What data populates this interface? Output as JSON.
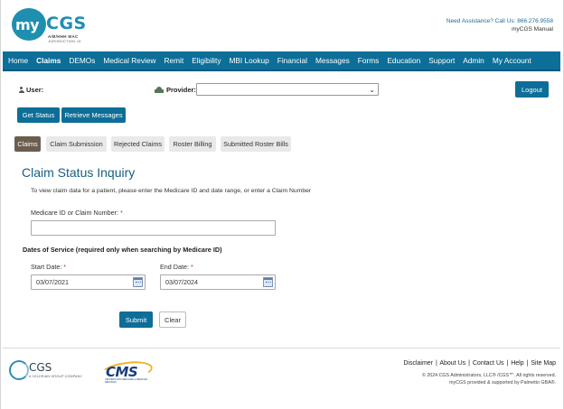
{
  "header": {
    "logo_my": "my",
    "logo_cgs": "CGS",
    "logo_line1": "A/B/HHH MAC",
    "logo_line2": "JURISDICTION 15",
    "assistance": "Need Assistance? Call Us: 866.276.9558",
    "manual": "myCGS Manual"
  },
  "nav": {
    "items": [
      "Home",
      "Claims",
      "DEMOs",
      "Medical Review",
      "Remit",
      "Eligibility",
      "MBI Lookup",
      "Financial",
      "Messages",
      "Forms",
      "Education",
      "Support",
      "Admin",
      "My Account"
    ],
    "active": "Claims"
  },
  "session": {
    "user_label": "User:",
    "provider_label": "Provider:",
    "provider_value": "",
    "logout_label": "Logout"
  },
  "actions": {
    "get_status": "Get Status",
    "retrieve_messages": "Retrieve Messages"
  },
  "tabs": [
    "Claims",
    "Claim Submission",
    "Rejected Claims",
    "Roster Billing",
    "Submitted Roster Bills"
  ],
  "form": {
    "title": "Claim Status Inquiry",
    "intro": "To view claim data for a patient, please enter the Medicare ID and date range, or enter a Claim Number",
    "medicare_label": "Medicare ID or Claim Number:",
    "medicare_value": "",
    "dates_heading": "Dates of Service (required only when searching by Medicare ID)",
    "start_label": "Start Date:",
    "start_value": "03/07/2021",
    "end_label": "End Date:",
    "end_value": "03/07/2024",
    "required_marker": "*",
    "submit": "Submit",
    "clear": "Clear"
  },
  "footer": {
    "cgs_name": "CGS",
    "cgs_tagline": "A CELERIAN GROUP COMPANY",
    "cms_name": "CMS",
    "cms_tagline": "CENTERS FOR MEDICARE & MEDICAID SERVICES",
    "links": [
      "Disclaimer",
      "About Us",
      "Contact Us",
      "Help",
      "Site Map"
    ],
    "separator": "|",
    "copyright": "© 2024 CGS Administrators, LLC® /CGS℠. All rights reserved.",
    "provided_by": "myCGS provided & supported by Palmetto GBA®."
  },
  "colors": {
    "nav_bg": "#0d6e98",
    "accent": "#1f8fb0",
    "active_tab": "#6b5e4f"
  }
}
